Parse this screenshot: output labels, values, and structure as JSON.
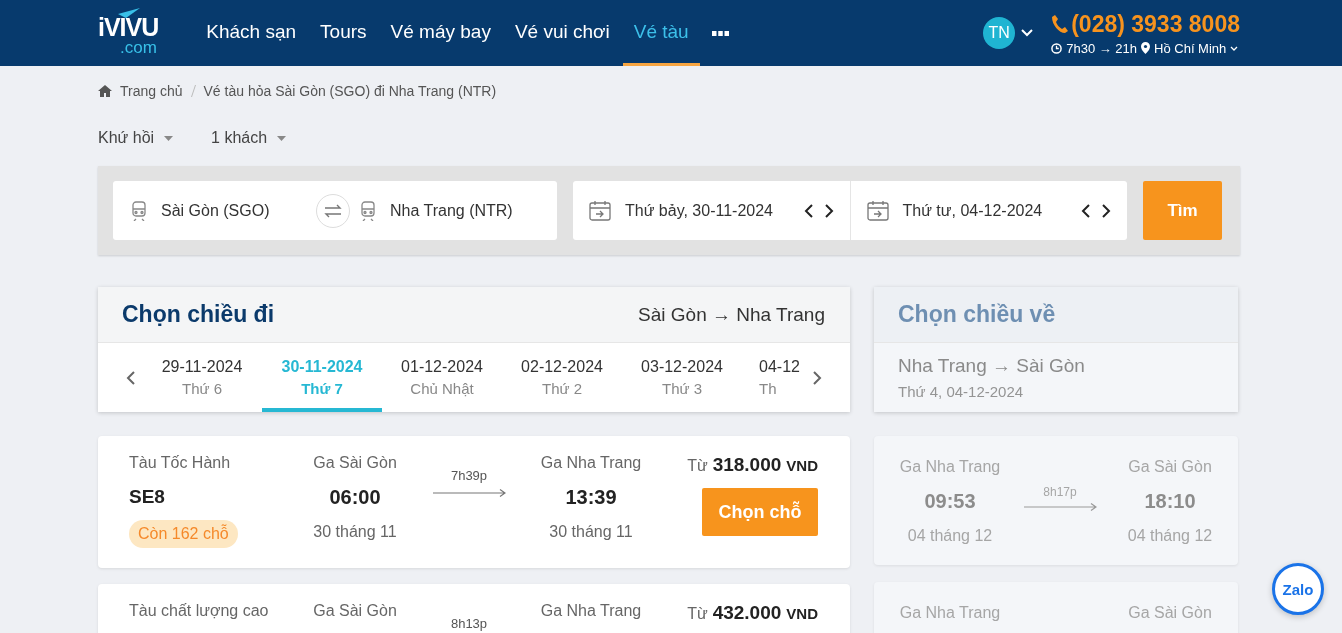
{
  "header": {
    "logo_text": "iVIVU",
    "logo_domain": ".com",
    "nav": [
      {
        "label": "Khách sạn",
        "selected": false
      },
      {
        "label": "Tours",
        "selected": false
      },
      {
        "label": "Vé máy bay",
        "selected": false
      },
      {
        "label": "Vé vui chơi",
        "selected": false
      },
      {
        "label": "Vé tàu",
        "selected": true
      }
    ],
    "avatar": "TN",
    "phone": "(028) 3933 8008",
    "hours": "7h30 → 21h",
    "city": "Hồ Chí Minh"
  },
  "breadcrumb": [
    "Trang chủ",
    "Vé tàu hỏa Sài Gòn (SGO) đi Nha Trang (NTR)"
  ],
  "trip_options": [
    "Khứ hồi",
    "1 khách"
  ],
  "search": {
    "from": "Sài Gòn (SGO)",
    "to": "Nha Trang (NTR)",
    "depart_date": "Thứ bảy, 30-11-2024",
    "return_date": "Thứ tư, 04-12-2024",
    "button": "Tìm"
  },
  "outbound": {
    "title": "Chọn chiều đi",
    "route": "Sài Gòn → Nha Trang",
    "dates": [
      {
        "date": "29-11-2024",
        "weekday": "Thứ 6",
        "selected": false
      },
      {
        "date": "30-11-2024",
        "weekday": "Thứ 7",
        "selected": true
      },
      {
        "date": "01-12-2024",
        "weekday": "Chủ Nhật",
        "selected": false
      },
      {
        "date": "02-12-2024",
        "weekday": "Thứ 2",
        "selected": false
      },
      {
        "date": "03-12-2024",
        "weekday": "Thứ 3",
        "selected": false
      },
      {
        "date": "04-12",
        "weekday": "Th",
        "selected": false
      }
    ]
  },
  "trains": [
    {
      "type": "Tàu Tốc Hành",
      "code": "SE8",
      "seats": "Còn 162 chỗ",
      "from_station": "Ga Sài Gòn",
      "depart_time": "06:00",
      "depart_date": "30 tháng 11",
      "duration": "7h39p",
      "to_station": "Ga Nha Trang",
      "arrive_time": "13:39",
      "arrive_date": "30 tháng 11",
      "price_prefix": "Từ",
      "price": "318.000",
      "currency": "VND",
      "button": "Chọn chỗ"
    },
    {
      "type": "Tàu chất lượng cao",
      "from_station": "Ga Sài Gòn",
      "duration": "8h13p",
      "to_station": "Ga Nha Trang",
      "price_prefix": "Từ",
      "price": "432.000",
      "currency": "VND"
    }
  ],
  "return": {
    "title": "Chọn chiều về",
    "route": "Nha Trang → Sài Gòn",
    "date": "Thứ 4, 04-12-2024",
    "disabled": true
  },
  "return_trains": [
    {
      "from_station": "Ga Nha Trang",
      "depart_time": "09:53",
      "depart_date": "04 tháng 12",
      "duration": "8h17p",
      "to_station": "Ga Sài Gòn",
      "arrive_time": "18:10",
      "arrive_date": "04 tháng 12"
    },
    {
      "from_station": "Ga Nha Trang",
      "to_station": "Ga Sài Gòn"
    }
  ],
  "chat": {
    "label": "Zalo"
  }
}
